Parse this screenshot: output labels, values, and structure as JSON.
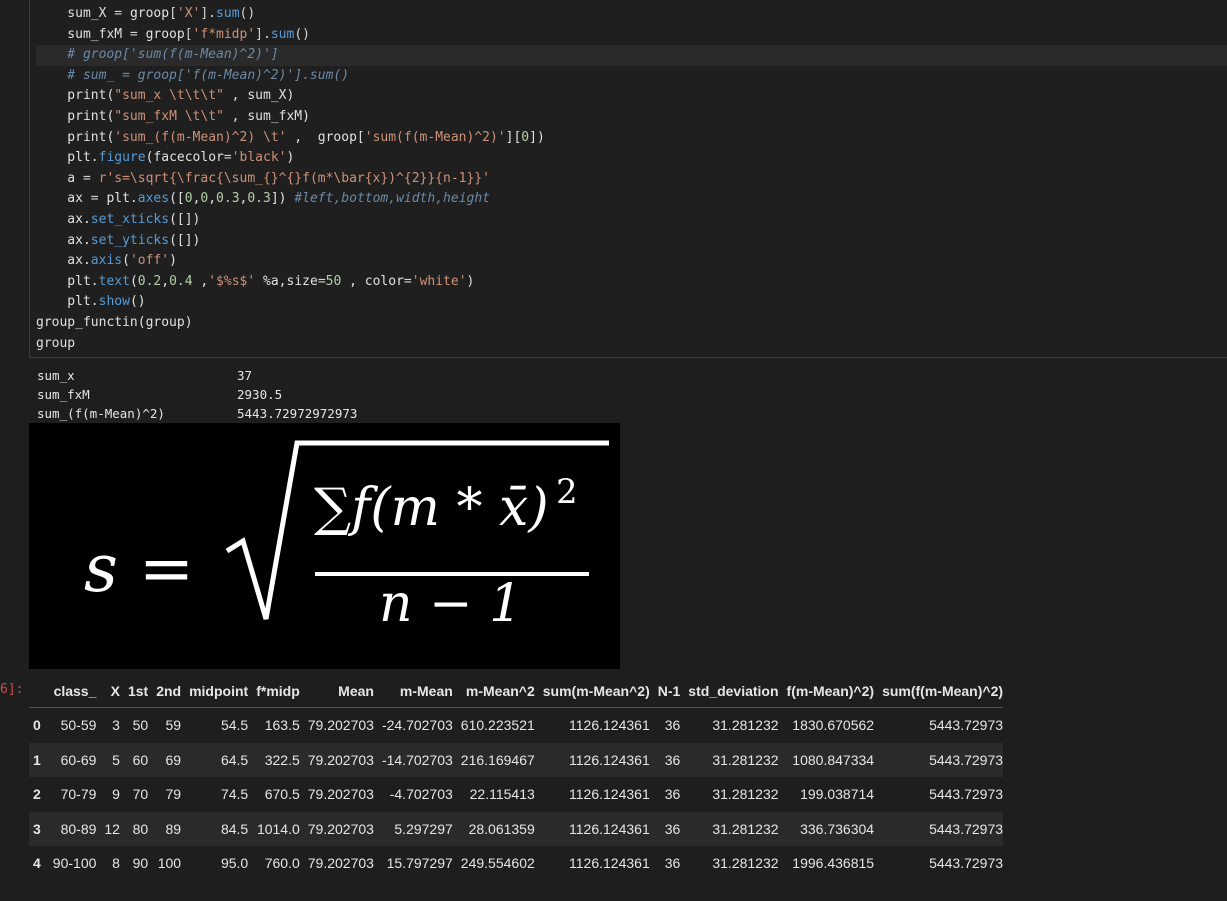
{
  "code": {
    "lines": [
      {
        "parts": [
          [
            "id",
            "    sum_X "
          ],
          [
            "op",
            "= "
          ],
          [
            "id",
            "groop"
          ],
          [
            "op",
            "["
          ],
          [
            "str",
            "'X'"
          ],
          [
            "op",
            "]."
          ],
          [
            "fn",
            "sum"
          ],
          [
            "op",
            "()"
          ]
        ]
      },
      {
        "parts": [
          [
            "id",
            "    sum_fxM "
          ],
          [
            "op",
            "= "
          ],
          [
            "id",
            "groop"
          ],
          [
            "op",
            "["
          ],
          [
            "str",
            "'f*midp'"
          ],
          [
            "op",
            "]."
          ],
          [
            "fn",
            "sum"
          ],
          [
            "op",
            "()"
          ]
        ]
      },
      {
        "parts": [
          [
            "cmg",
            "    # groop['sum(f(m-Mean)^2)']"
          ]
        ],
        "highlight": true
      },
      {
        "parts": [
          [
            "cmg",
            "    # sum_ = groop['f(m-Mean)^2)'].sum()"
          ]
        ]
      },
      {
        "parts": [
          [
            "id",
            "    print("
          ],
          [
            "str",
            "\"sum_x \\t\\t\\t\""
          ],
          [
            "id",
            " , sum_X)"
          ]
        ]
      },
      {
        "parts": [
          [
            "id",
            "    print("
          ],
          [
            "str",
            "\"sum_fxM \\t\\t\""
          ],
          [
            "id",
            " , sum_fxM)"
          ]
        ]
      },
      {
        "parts": [
          [
            "id",
            "    print("
          ],
          [
            "str",
            "'sum_(f(m-Mean)^2) \\t'"
          ],
          [
            "id",
            " ,  groop["
          ],
          [
            "str",
            "'sum(f(m-Mean)^2)'"
          ],
          [
            "id",
            "]["
          ],
          [
            "num",
            "0"
          ],
          [
            "id",
            "])"
          ]
        ]
      },
      {
        "parts": [
          [
            "id",
            "    plt."
          ],
          [
            "fn",
            "figure"
          ],
          [
            "id",
            "(facecolor"
          ],
          [
            "op",
            "="
          ],
          [
            "str",
            "'black'"
          ],
          [
            "id",
            ")"
          ]
        ]
      },
      {
        "parts": [
          [
            "id",
            "    a "
          ],
          [
            "op",
            "= "
          ],
          [
            "str",
            "r's=\\sqrt{\\frac{\\sum_{}^{}f(m*\\bar{x})^{2}}{n-1}}'"
          ]
        ]
      },
      {
        "parts": [
          [
            "id",
            "    ax "
          ],
          [
            "op",
            "= "
          ],
          [
            "id",
            "plt."
          ],
          [
            "fn",
            "axes"
          ],
          [
            "id",
            "(["
          ],
          [
            "num",
            "0"
          ],
          [
            "id",
            ","
          ],
          [
            "num",
            "0"
          ],
          [
            "id",
            ","
          ],
          [
            "num",
            "0.3"
          ],
          [
            "id",
            ","
          ],
          [
            "num",
            "0.3"
          ],
          [
            "id",
            "]) "
          ],
          [
            "cmg",
            "#left,bottom,width,height"
          ]
        ]
      },
      {
        "parts": [
          [
            "id",
            "    ax."
          ],
          [
            "fn",
            "set_xticks"
          ],
          [
            "id",
            "([])"
          ]
        ]
      },
      {
        "parts": [
          [
            "id",
            "    ax."
          ],
          [
            "fn",
            "set_yticks"
          ],
          [
            "id",
            "([])"
          ]
        ]
      },
      {
        "parts": [
          [
            "id",
            "    ax."
          ],
          [
            "fn",
            "axis"
          ],
          [
            "id",
            "("
          ],
          [
            "str",
            "'off'"
          ],
          [
            "id",
            ")"
          ]
        ]
      },
      {
        "parts": [
          [
            "id",
            "    plt."
          ],
          [
            "fn",
            "text"
          ],
          [
            "id",
            "("
          ],
          [
            "num",
            "0.2"
          ],
          [
            "id",
            ","
          ],
          [
            "num",
            "0.4"
          ],
          [
            "id",
            " ,"
          ],
          [
            "str",
            "'$%s$'"
          ],
          [
            "id",
            " %a,size"
          ],
          [
            "op",
            "="
          ],
          [
            "num",
            "50"
          ],
          [
            "id",
            " , color"
          ],
          [
            "op",
            "="
          ],
          [
            "str",
            "'white'"
          ],
          [
            "id",
            ")"
          ]
        ]
      },
      {
        "parts": [
          [
            "id",
            "    plt."
          ],
          [
            "fn",
            "show"
          ],
          [
            "id",
            "()"
          ]
        ]
      },
      {
        "parts": [
          [
            "id",
            "group_functin(group)"
          ]
        ]
      },
      {
        "parts": [
          [
            "id",
            "group"
          ]
        ]
      }
    ]
  },
  "output": {
    "rows": [
      {
        "key": "sum_x",
        "value": "37"
      },
      {
        "key": "sum_fxM",
        "value": "2930.5"
      },
      {
        "key": "sum_(f(m-Mean)^2)",
        "value": "5443.72972972973"
      }
    ]
  },
  "formula": {
    "lhs": "s =",
    "numerator": "∑f(m * x̄)",
    "exponent": "2",
    "denominator": "n − 1"
  },
  "prompt_label": "6]:",
  "table": {
    "columns": [
      "",
      "class_",
      "X",
      "1st",
      "2nd",
      "midpoint",
      "f*midp",
      "Mean",
      "m-Mean",
      "m-Mean^2",
      "sum(m-Mean^2)",
      "N-1",
      "std_deviation",
      "f(m-Mean)^2)",
      "sum(f(m-Mean)^2)"
    ],
    "rows": [
      [
        "0",
        "50-59",
        "3",
        "50",
        "59",
        "54.5",
        "163.5",
        "79.202703",
        "-24.702703",
        "610.223521",
        "1126.124361",
        "36",
        "31.281232",
        "1830.670562",
        "5443.72973"
      ],
      [
        "1",
        "60-69",
        "5",
        "60",
        "69",
        "64.5",
        "322.5",
        "79.202703",
        "-14.702703",
        "216.169467",
        "1126.124361",
        "36",
        "31.281232",
        "1080.847334",
        "5443.72973"
      ],
      [
        "2",
        "70-79",
        "9",
        "70",
        "79",
        "74.5",
        "670.5",
        "79.202703",
        "-4.702703",
        "22.115413",
        "1126.124361",
        "36",
        "31.281232",
        "199.038714",
        "5443.72973"
      ],
      [
        "3",
        "80-89",
        "12",
        "80",
        "89",
        "84.5",
        "1014.0",
        "79.202703",
        "5.297297",
        "28.061359",
        "1126.124361",
        "36",
        "31.281232",
        "336.736304",
        "5443.72973"
      ],
      [
        "4",
        "90-100",
        "8",
        "90",
        "100",
        "95.0",
        "760.0",
        "79.202703",
        "15.797297",
        "249.554602",
        "1126.124361",
        "36",
        "31.281232",
        "1996.436815",
        "5443.72973"
      ]
    ]
  }
}
